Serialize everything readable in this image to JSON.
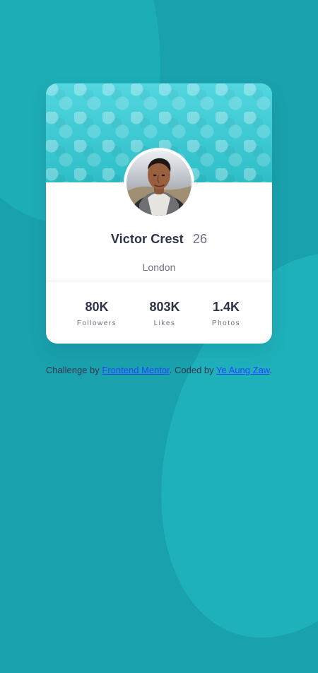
{
  "colors": {
    "background": "#19a2ae",
    "card_background": "#ffffff",
    "header_background": "#39c5cf",
    "primary_text": "#2e3349",
    "secondary_text": "#6b7082",
    "link": "#2441ff"
  },
  "profile": {
    "name": "Victor Crest",
    "age": "26",
    "location": "London",
    "avatar_icon": "avatar-icon"
  },
  "stats": [
    {
      "value": "80K",
      "label": "Followers"
    },
    {
      "value": "803K",
      "label": "Likes"
    },
    {
      "value": "1.4K",
      "label": "Photos"
    }
  ],
  "attribution": {
    "prefix": "Challenge by ",
    "frontend_link": "Frontend Mentor",
    "middle": ". Coded by ",
    "author_link": "Ye Aung Zaw",
    "suffix": "."
  }
}
